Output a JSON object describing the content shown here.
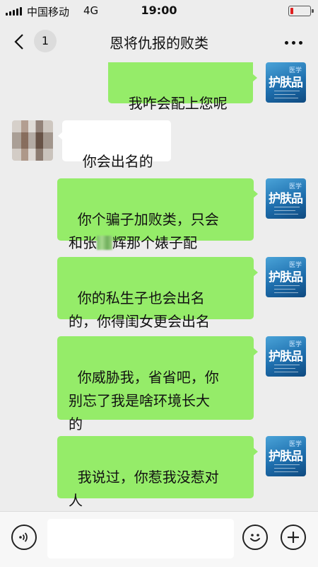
{
  "status_bar": {
    "carrier": "中国移动",
    "network": "4G",
    "time": "19:00"
  },
  "nav": {
    "back_count": "1",
    "title": "恩将仇报的败类"
  },
  "avatar_me": {
    "top_text": "医学",
    "main_text": "护肤品"
  },
  "messages": [
    {
      "from": "me",
      "text": "我咋会配上您呢"
    },
    {
      "from": "other",
      "text": "你会出名的"
    },
    {
      "from": "me",
      "text_before": "你个骗子加败类，只会\n和张",
      "text_after": "辉那个婊子配"
    },
    {
      "from": "me",
      "text": "你的私生子也会出名\n的，你得闺女更会出名"
    },
    {
      "from": "me",
      "text": "你威胁我，省省吧，你\n别忘了我是啥环境长大\n的"
    },
    {
      "from": "me",
      "text": "我说过，你惹我没惹对\n人"
    }
  ],
  "input_bar": {
    "placeholder": ""
  },
  "colors": {
    "outgoing_bubble": "#95ec69",
    "incoming_bubble": "#ffffff",
    "background": "#ededed"
  },
  "icons": [
    "back-chevron-icon",
    "more-icon",
    "voice-icon",
    "emoji-icon",
    "plus-icon",
    "signal-icon",
    "battery-icon"
  ]
}
